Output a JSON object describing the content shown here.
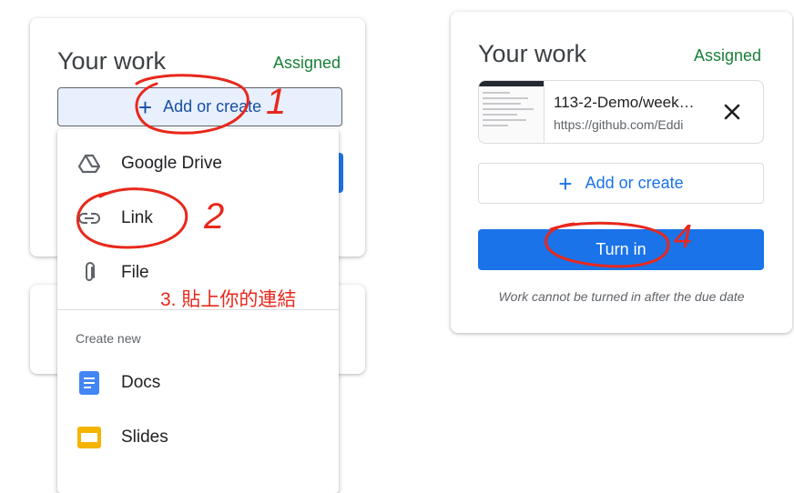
{
  "left_panel": {
    "title": "Your work",
    "status": "Assigned",
    "add_button_label": "Add or create",
    "menu": {
      "items": [
        {
          "label": "Google Drive",
          "icon": "google-drive-icon"
        },
        {
          "label": "Link",
          "icon": "link-icon"
        },
        {
          "label": "File",
          "icon": "paperclip-icon"
        }
      ],
      "section_label": "Create new",
      "create_items": [
        {
          "label": "Docs",
          "icon": "docs-icon",
          "color": "#4285f4"
        },
        {
          "label": "Slides",
          "icon": "slides-icon",
          "color": "#f4b400"
        }
      ]
    }
  },
  "right_panel": {
    "title": "Your work",
    "status": "Assigned",
    "attachment": {
      "title": "113-2-Demo/week…",
      "url": "https://github.com/Eddi"
    },
    "add_button_label": "Add or create",
    "turn_in_label": "Turn in",
    "note": "Work cannot be turned in after the due date"
  },
  "annotations": {
    "step1": "1",
    "step2": "2",
    "step3": "3. 貼上你的連結",
    "step4": "4",
    "color": "#e8281c"
  },
  "colors": {
    "accent": "#1a73e8",
    "assigned": "#188038"
  }
}
